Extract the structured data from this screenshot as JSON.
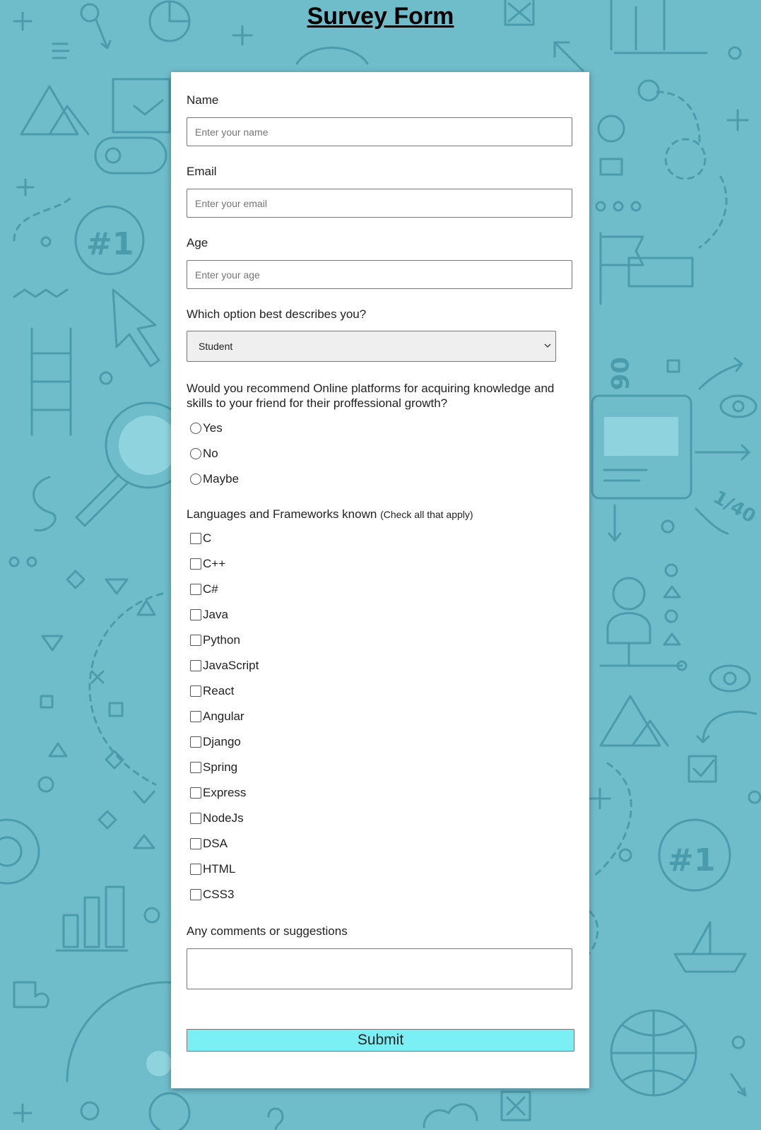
{
  "page": {
    "title": "Survey Form"
  },
  "form": {
    "name": {
      "label": "Name",
      "placeholder": "Enter your name"
    },
    "email": {
      "label": "Email",
      "placeholder": "Enter your email"
    },
    "age": {
      "label": "Age",
      "placeholder": "Enter your age"
    },
    "role": {
      "label": "Which option best describes you?",
      "selected": "Student"
    },
    "recommend": {
      "question": "Would you recommend Online platforms for acquiring knowledge and skills to your friend for their proffessional growth?",
      "options": [
        "Yes",
        "No",
        "Maybe"
      ]
    },
    "languages": {
      "label": "Languages and Frameworks known",
      "hint": "(Check all that apply)",
      "options": [
        "C",
        "C++",
        "C#",
        "Java",
        "Python",
        "JavaScript",
        "React",
        "Angular",
        "Django",
        "Spring",
        "Express",
        "NodeJs",
        "DSA",
        "HTML",
        "CSS3"
      ]
    },
    "comments": {
      "label": "Any comments or suggestions"
    },
    "submit_label": "Submit"
  },
  "colors": {
    "background": "#6fbccb",
    "submit": "#7af0f5",
    "card": "#ffffff"
  }
}
